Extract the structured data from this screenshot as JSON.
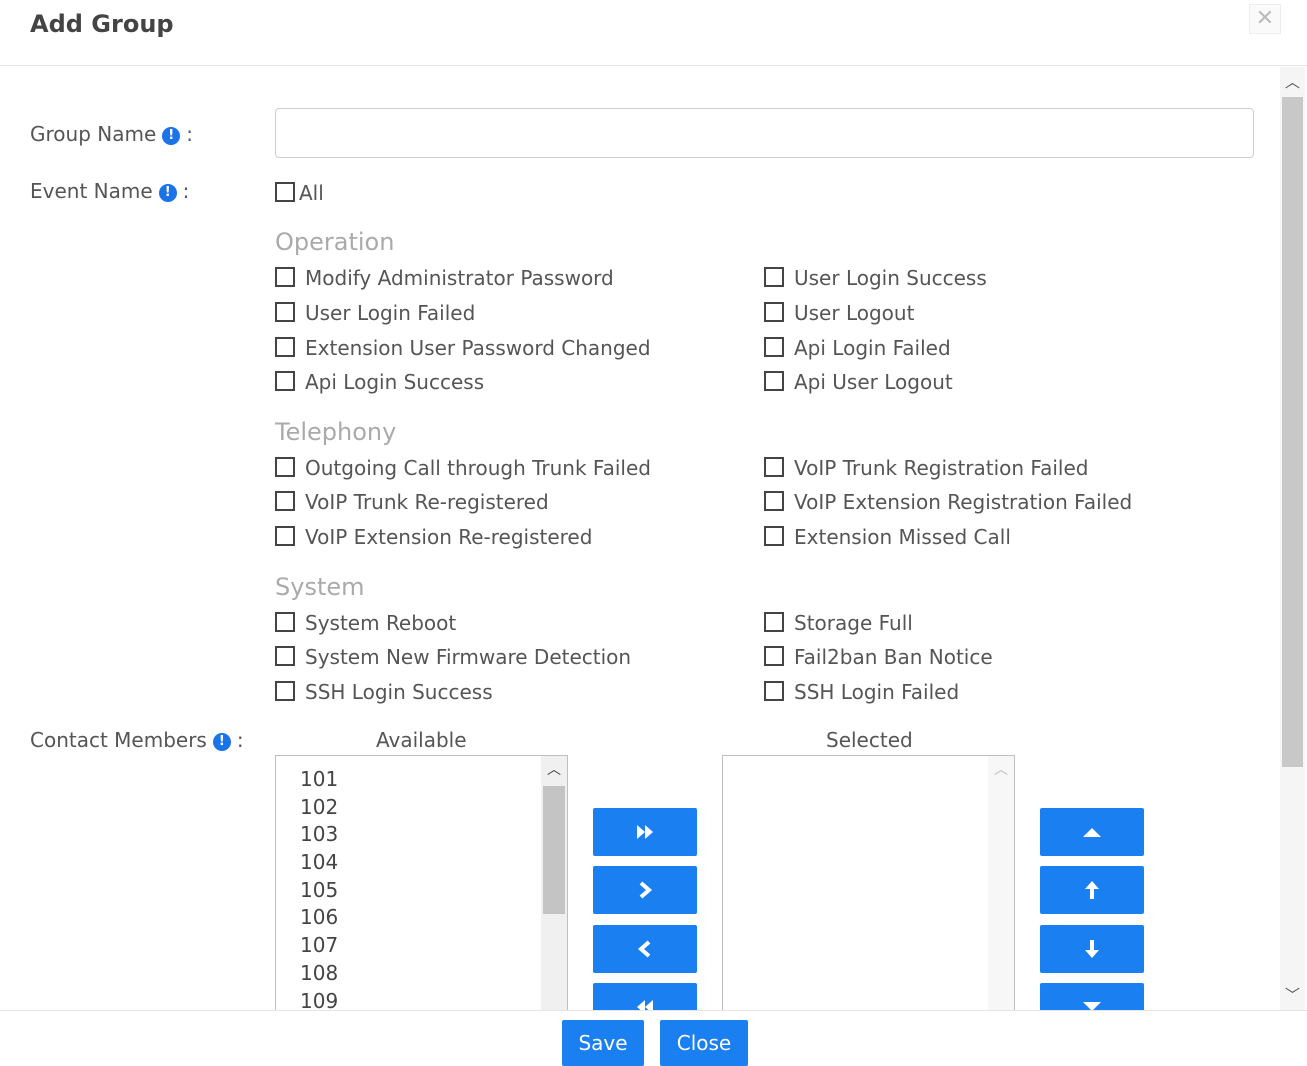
{
  "dialog": {
    "title": "Add Group",
    "close_glyph": "✕"
  },
  "form": {
    "group_name_label": "Group Name",
    "event_name_label": "Event Name",
    "contact_members_label": "Contact Members",
    "colon": ":",
    "info_glyph": "!",
    "group_name_value": "",
    "all_label": "All"
  },
  "sections": [
    {
      "title": "Operation",
      "items": [
        [
          "Modify Administrator Password",
          "User Login Success"
        ],
        [
          "User Login Failed",
          "User Logout"
        ],
        [
          "Extension User Password Changed",
          "Api Login Failed"
        ],
        [
          "Api Login Success",
          "Api User Logout"
        ]
      ]
    },
    {
      "title": "Telephony",
      "items": [
        [
          "Outgoing Call through Trunk Failed",
          "VoIP Trunk Registration Failed"
        ],
        [
          "VoIP Trunk Re-registered",
          "VoIP Extension Registration Failed"
        ],
        [
          "VoIP Extension Re-registered",
          "Extension Missed Call"
        ]
      ]
    },
    {
      "title": "System",
      "items": [
        [
          "System Reboot",
          "Storage Full"
        ],
        [
          "System New Firmware Detection",
          "Fail2ban Ban Notice"
        ],
        [
          "SSH Login Success",
          "SSH Login Failed"
        ]
      ]
    }
  ],
  "members": {
    "available_label": "Available",
    "selected_label": "Selected",
    "available": [
      "101",
      "102",
      "103",
      "104",
      "105",
      "106",
      "107",
      "108",
      "109"
    ],
    "selected": []
  },
  "icons": {
    "info": "info-icon",
    "close": "close-icon",
    "add_all": "double-chevron-right-icon",
    "add": "chevron-right-icon",
    "remove": "chevron-left-icon",
    "remove_all": "double-chevron-left-icon",
    "move_top": "triangle-up-icon",
    "move_up": "arrow-up-icon",
    "move_down": "arrow-down-icon",
    "move_bottom": "triangle-down-icon"
  },
  "colors": {
    "accent": "#1a7ff0",
    "info": "#1a73e8",
    "section": "#aaaaaa"
  },
  "footer": {
    "save_label": "Save",
    "close_label": "Close"
  }
}
